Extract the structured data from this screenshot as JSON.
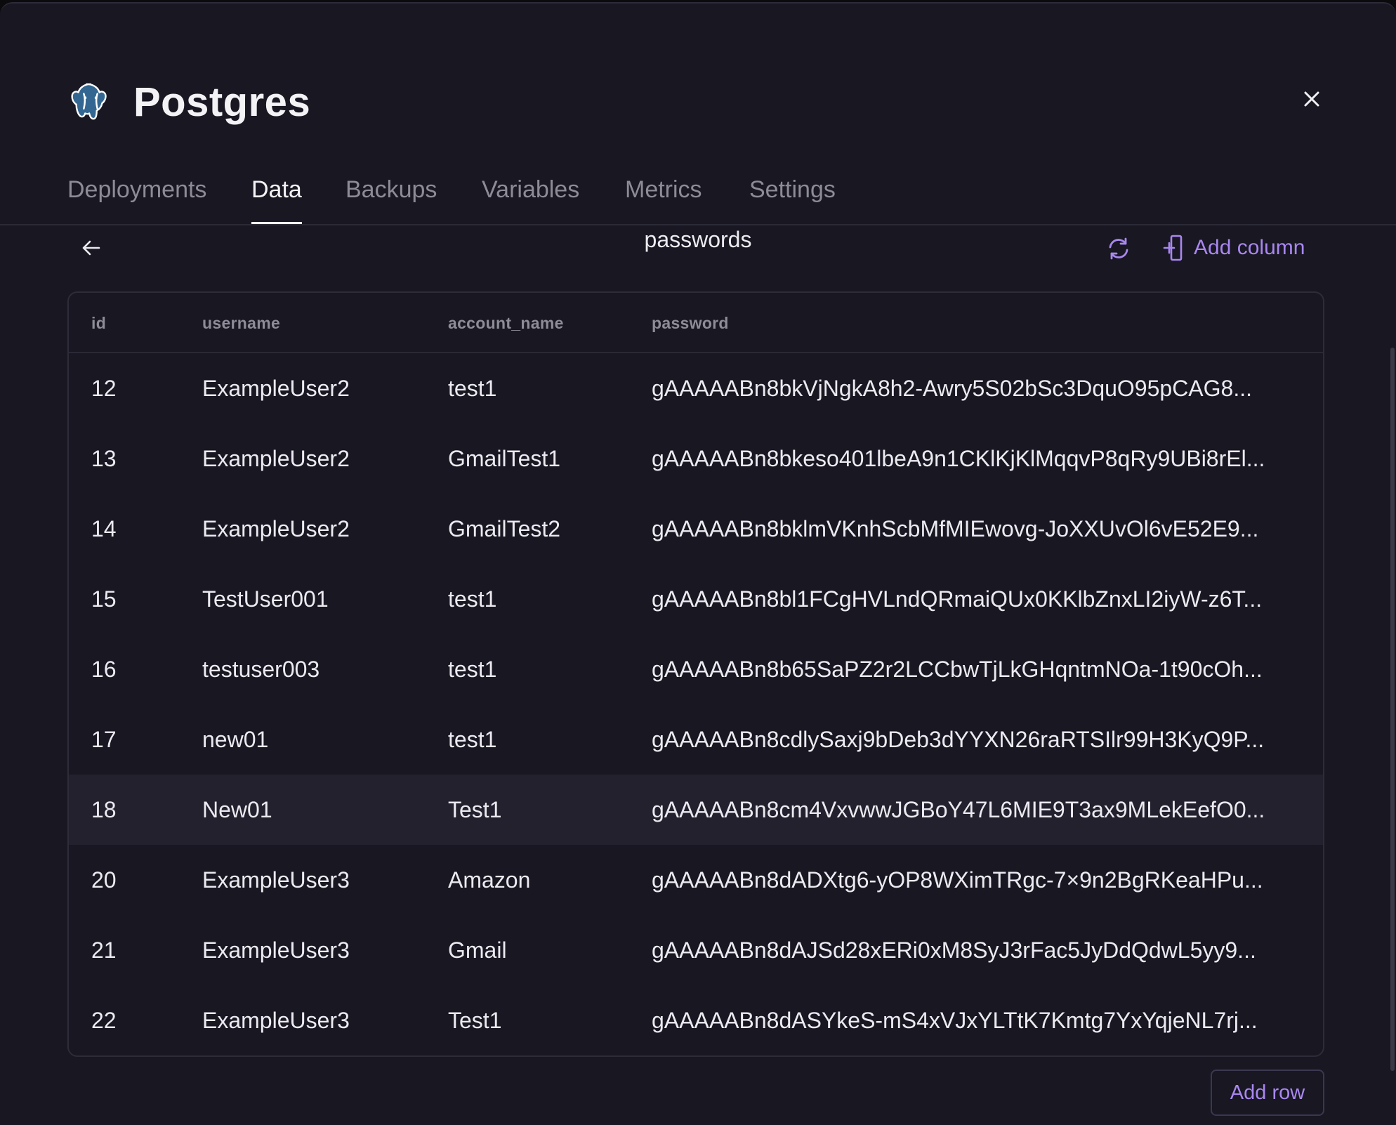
{
  "app": {
    "title": "Postgres",
    "logo_icon": "postgres-elephant-icon"
  },
  "tabs": [
    {
      "label": "Deployments",
      "active": false
    },
    {
      "label": "Data",
      "active": true
    },
    {
      "label": "Backups",
      "active": false
    },
    {
      "label": "Variables",
      "active": false
    },
    {
      "label": "Metrics",
      "active": false
    },
    {
      "label": "Settings",
      "active": false
    }
  ],
  "toolbar": {
    "table_name": "passwords",
    "add_column_label": "Add column",
    "refresh_icon": "refresh-icon",
    "back_icon": "arrow-left-icon"
  },
  "table": {
    "columns": [
      "id",
      "username",
      "account_name",
      "password"
    ],
    "rows": [
      {
        "id": "12",
        "username": "ExampleUser2",
        "account_name": "test1",
        "password": "gAAAAABn8bkVjNgkA8h2-Awry5S02bSc3DquO95pCAG8...",
        "highlighted": false
      },
      {
        "id": "13",
        "username": "ExampleUser2",
        "account_name": "GmailTest1",
        "password": "gAAAAABn8bkeso401lbeA9n1CKlKjKlMqqvP8qRy9UBi8rEl...",
        "highlighted": false
      },
      {
        "id": "14",
        "username": "ExampleUser2",
        "account_name": "GmailTest2",
        "password": "gAAAAABn8bklmVKnhScbMfMIEwovg-JoXXUvOl6vE52E9...",
        "highlighted": false
      },
      {
        "id": "15",
        "username": "TestUser001",
        "account_name": "test1",
        "password": "gAAAAABn8bl1FCgHVLndQRmaiQUx0KKlbZnxLI2iyW-z6T...",
        "highlighted": false
      },
      {
        "id": "16",
        "username": "testuser003",
        "account_name": "test1",
        "password": "gAAAAABn8b65SaPZ2r2LCCbwTjLkGHqntmNOa-1t90cOh...",
        "highlighted": false
      },
      {
        "id": "17",
        "username": "new01",
        "account_name": "test1",
        "password": "gAAAAABn8cdlySaxj9bDeb3dYYXN26raRTSIlr99H3KyQ9P...",
        "highlighted": false
      },
      {
        "id": "18",
        "username": "New01",
        "account_name": "Test1",
        "password": "gAAAAABn8cm4VxvwwJGBoY47L6MIE9T3ax9MLekEefO0...",
        "highlighted": true
      },
      {
        "id": "20",
        "username": "ExampleUser3",
        "account_name": "Amazon",
        "password": "gAAAAABn8dADXtg6-yOP8WXimTRgc-7×9n2BgRKeaHPu...",
        "highlighted": false
      },
      {
        "id": "21",
        "username": "ExampleUser3",
        "account_name": "Gmail",
        "password": "gAAAAABn8dAJSd28xERi0xM8SyJ3rFac5JyDdQdwL5yy9...",
        "highlighted": false
      },
      {
        "id": "22",
        "username": "ExampleUser3",
        "account_name": "Test1",
        "password": "gAAAAABn8dASYkeS-mS4xVJxYLTtK7Kmtg7YxYqjeNL7rj...",
        "highlighted": false
      }
    ]
  },
  "footer": {
    "add_row_label": "Add row"
  },
  "colors": {
    "accent": "#a987f0",
    "background": "#181722",
    "row_highlight": "#22212d"
  }
}
